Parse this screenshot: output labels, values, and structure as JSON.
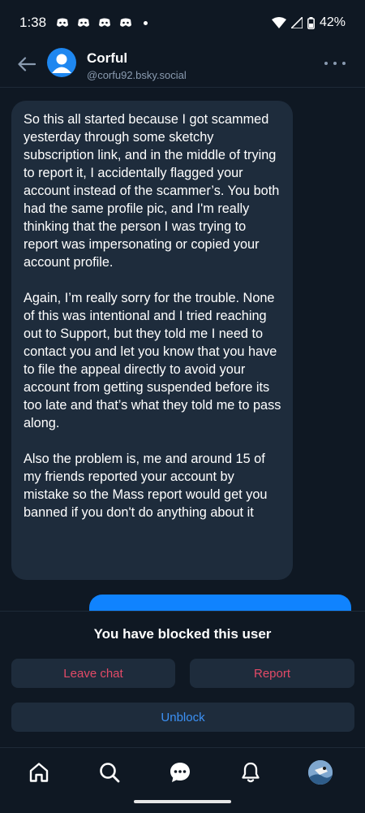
{
  "status_bar": {
    "time": "1:38",
    "battery": "42%"
  },
  "header": {
    "name": "Corful",
    "handle": "@corfu92.bsky.social"
  },
  "message": {
    "paragraphs": [
      "So this all started because I got scammed yesterday through some sketchy subscription link, and in the middle of trying to report it, I accidentally flagged your account instead of the scammer’s. You both had the same profile pic, and I'm really thinking that the person I was trying to report was impersonating or copied your account profile.",
      "Again, I’m really sorry for the trouble. None of this was intentional and I tried reaching out to Support, but they told me I need to contact you and let you know that you have to file the appeal directly to avoid your account from getting suspended before its too late and that’s what they told me to pass along.",
      "Also the problem is, me and around 15 of my friends reported your account by mistake so the Mass report would get you banned if you don't do anything about it"
    ]
  },
  "blocked": {
    "text": "You have blocked this user",
    "leave_label": "Leave chat",
    "report_label": "Report",
    "unblock_label": "Unblock"
  },
  "icons": {
    "back": "arrow-left-icon",
    "more": "ellipsis-icon",
    "home": "home-icon",
    "search": "search-icon",
    "chat": "chat-icon",
    "notifications": "bell-icon"
  },
  "colors": {
    "background": "#0f1823",
    "bubble": "#1e2c3c",
    "danger": "#e34a67",
    "accent": "#3c91f5",
    "sent_bubble": "#1083fe"
  }
}
